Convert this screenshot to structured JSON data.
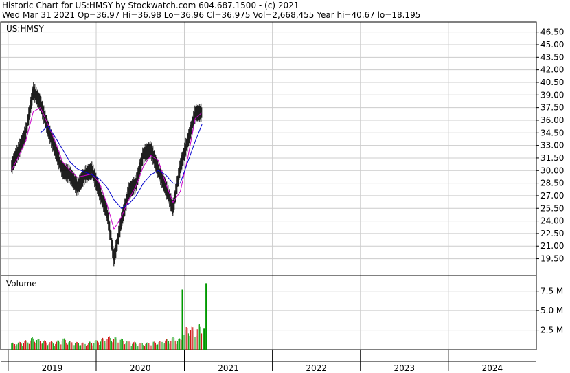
{
  "header": {
    "line1": "Historic Chart for US:HMSY by Stockwatch.com 604.687.1500 - (c) 2021",
    "line2": "Wed Mar 31 2021   Op=36.97   Hi=36.98   Lo=36.96   Cl=36.975   Vol=2,668,455   Year hi=40.67   lo=18.195"
  },
  "colors": {
    "price": "#000000",
    "ma_short": "#cc00cc",
    "ma_long": "#0000cc",
    "vol_up": "#009900",
    "vol_down": "#cc0000",
    "grid": "#cccccc"
  },
  "chart_data": [
    {
      "type": "line",
      "title": "US:HMSY",
      "ylim": [
        17.5,
        47.7
      ],
      "y_ticks": [
        "46.50",
        "45.00",
        "43.50",
        "42.00",
        "40.50",
        "39.00",
        "37.50",
        "36.00",
        "34.50",
        "33.00",
        "31.50",
        "30.00",
        "28.50",
        "27.00",
        "25.50",
        "24.00",
        "22.50",
        "21.00",
        "19.50"
      ],
      "grid": true,
      "series": [
        {
          "style": "price-bars",
          "x": [
            "2019-01",
            "2019-02",
            "2019-03",
            "2019-04",
            "2019-05",
            "2019-06",
            "2019-07",
            "2019-08",
            "2019-09",
            "2019-10",
            "2019-11",
            "2019-12",
            "2020-01",
            "2020-02",
            "2020-03",
            "2020-04",
            "2020-05",
            "2020-06",
            "2020-07",
            "2020-08",
            "2020-09",
            "2020-10",
            "2020-11",
            "2020-12",
            "2021-01",
            "2021-02",
            "2021-03"
          ],
          "values": [
            30.5,
            32.5,
            34.5,
            39.5,
            38.0,
            35.0,
            32.5,
            30.0,
            29.5,
            28.0,
            29.5,
            30.0,
            27.5,
            25.0,
            19.5,
            24.0,
            27.5,
            28.5,
            32.0,
            32.5,
            30.0,
            28.0,
            25.5,
            30.5,
            33.5,
            36.8,
            36.9
          ]
        },
        {
          "style": "moving-average-short",
          "x": [
            "2019-01",
            "2019-02",
            "2019-03",
            "2019-04",
            "2019-05",
            "2019-06",
            "2019-07",
            "2019-08",
            "2019-09",
            "2019-10",
            "2019-11",
            "2019-12",
            "2020-01",
            "2020-02",
            "2020-03",
            "2020-04",
            "2020-05",
            "2020-06",
            "2020-07",
            "2020-08",
            "2020-09",
            "2020-10",
            "2020-11",
            "2020-12",
            "2021-01",
            "2021-02",
            "2021-03"
          ],
          "values": [
            30.0,
            31.8,
            33.5,
            37.0,
            37.5,
            35.5,
            33.5,
            31.0,
            30.0,
            29.2,
            29.4,
            29.6,
            28.5,
            26.0,
            23.0,
            24.5,
            26.5,
            28.2,
            30.5,
            31.8,
            31.2,
            28.5,
            26.2,
            27.5,
            31.5,
            36.2,
            36.9
          ]
        },
        {
          "style": "moving-average-long",
          "x": [
            "2019-01",
            "2019-02",
            "2019-03",
            "2019-04",
            "2019-05",
            "2019-06",
            "2019-07",
            "2019-08",
            "2019-09",
            "2019-10",
            "2019-11",
            "2019-12",
            "2020-01",
            "2020-02",
            "2020-03",
            "2020-04",
            "2020-05",
            "2020-06",
            "2020-07",
            "2020-08",
            "2020-09",
            "2020-10",
            "2020-11",
            "2020-12",
            "2021-01",
            "2021-02",
            "2021-03"
          ],
          "values": [
            null,
            null,
            null,
            null,
            34.5,
            35.3,
            34.0,
            32.5,
            31.0,
            30.2,
            29.8,
            29.5,
            29.0,
            28.0,
            26.5,
            25.5,
            26.0,
            27.0,
            28.5,
            29.5,
            30.0,
            29.5,
            28.5,
            28.5,
            31.0,
            33.5,
            35.5
          ]
        }
      ]
    },
    {
      "type": "bar",
      "title": "Volume",
      "ylim": [
        0,
        9.5
      ],
      "y_ticks": [
        "7.5 M",
        "5.0 M",
        "2.5 M"
      ],
      "x_ticks": [
        "2019",
        "2020",
        "2021",
        "2022",
        "2023",
        "2024"
      ],
      "grid": true,
      "x": [
        "2019-01",
        "2019-02",
        "2019-03",
        "2019-04",
        "2019-05",
        "2019-06",
        "2019-07",
        "2019-08",
        "2019-09",
        "2019-10",
        "2019-11",
        "2019-12",
        "2020-01",
        "2020-02",
        "2020-03",
        "2020-04",
        "2020-05",
        "2020-06",
        "2020-07",
        "2020-08",
        "2020-09",
        "2020-10",
        "2020-11",
        "2020-12",
        "2021-01",
        "2021-02",
        "2021-03"
      ],
      "values": [
        0.8,
        0.9,
        1.1,
        1.5,
        1.2,
        1.0,
        0.9,
        1.4,
        1.0,
        0.9,
        0.8,
        1.0,
        1.2,
        1.6,
        1.5,
        1.3,
        1.0,
        0.9,
        0.8,
        0.9,
        1.0,
        1.2,
        1.5,
        1.3,
        3.0,
        2.5,
        3.5
      ],
      "spikes": [
        {
          "x": "2020-12",
          "value": 7.7
        },
        {
          "x": "2021-03",
          "value": 8.5
        },
        {
          "x": "2021-03",
          "value": 2.7
        }
      ],
      "legend": "none"
    }
  ]
}
